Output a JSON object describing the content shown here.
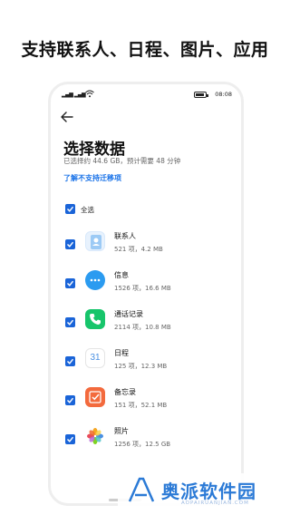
{
  "promo": {
    "title": "支持联系人、日程、图片、应用"
  },
  "status_bar": {
    "time": "08:08",
    "signal": "▂▄▆ ▂▄▆"
  },
  "header": {
    "title": "选择数据",
    "subtitle": "已选择约 44.6 GB，预计需要 48 分钟",
    "link": "了解不支持迁移项"
  },
  "select_all": {
    "label": "全选",
    "checked": true
  },
  "items": [
    {
      "name": "联系人",
      "meta": "521 项，4.2 MB",
      "icon": "contacts-icon",
      "checked": true
    },
    {
      "name": "信息",
      "meta": "1526 项，16.6 MB",
      "icon": "messages-icon",
      "checked": true
    },
    {
      "name": "通话记录",
      "meta": "2114 项，10.8 MB",
      "icon": "phone-icon",
      "checked": true
    },
    {
      "name": "日程",
      "meta": "125 项，12.3 MB",
      "icon": "calendar-icon",
      "icon_text": "31",
      "checked": true
    },
    {
      "name": "备忘录",
      "meta": "151 项，52.1 MB",
      "icon": "notes-icon",
      "checked": true
    },
    {
      "name": "照片",
      "meta": "1256 项，12.5 GB",
      "icon": "gallery-icon",
      "checked": true
    }
  ],
  "watermark": {
    "text": "奥派软件园",
    "url": "AOPAIRUANJIAN.COM"
  },
  "colors": {
    "accent": "#1a64d8",
    "link": "#1a73e8",
    "watermark": "#2b7ad6"
  }
}
